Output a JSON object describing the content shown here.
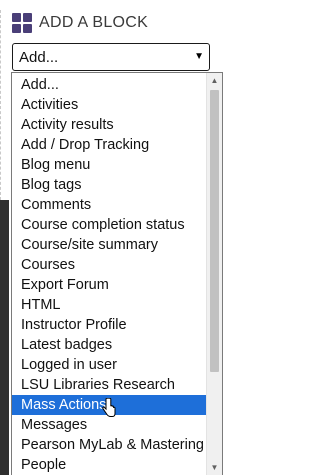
{
  "block": {
    "title": "ADD A BLOCK",
    "icon": "block-grid-icon",
    "icon_color": "#4a3f78"
  },
  "select": {
    "value": "Add...",
    "arrow_icon": "dropdown-arrow-icon"
  },
  "dropdown": {
    "options": [
      "Add...",
      "Activities",
      "Activity results",
      "Add / Drop Tracking",
      "Blog menu",
      "Blog tags",
      "Comments",
      "Course completion status",
      "Course/site summary",
      "Courses",
      "Export Forum",
      "HTML",
      "Instructor Profile",
      "Latest badges",
      "Logged in user",
      "LSU Libraries Research",
      "Mass Actions",
      "Messages",
      "Pearson MyLab & Mastering",
      "People"
    ],
    "selected": "Mass Actions",
    "highlight_color": "#1e6fd9"
  },
  "cursor_icon": "hand-pointer-icon"
}
